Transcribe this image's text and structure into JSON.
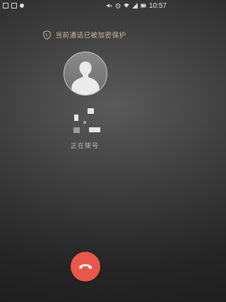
{
  "status_bar": {
    "left_icons": [
      "message-icon",
      "image-icon",
      "record-icon"
    ],
    "right_icons": [
      "mute-icon",
      "alarm-icon",
      "wifi-icon",
      "signal-icon",
      "battery-icon"
    ],
    "time": "10:57"
  },
  "call": {
    "encryption_notice": "当前通话已被加密保护",
    "status": "正在拨号"
  },
  "colors": {
    "notice_gold": "#c7ba97",
    "hangup_red": "#e8574a"
  }
}
